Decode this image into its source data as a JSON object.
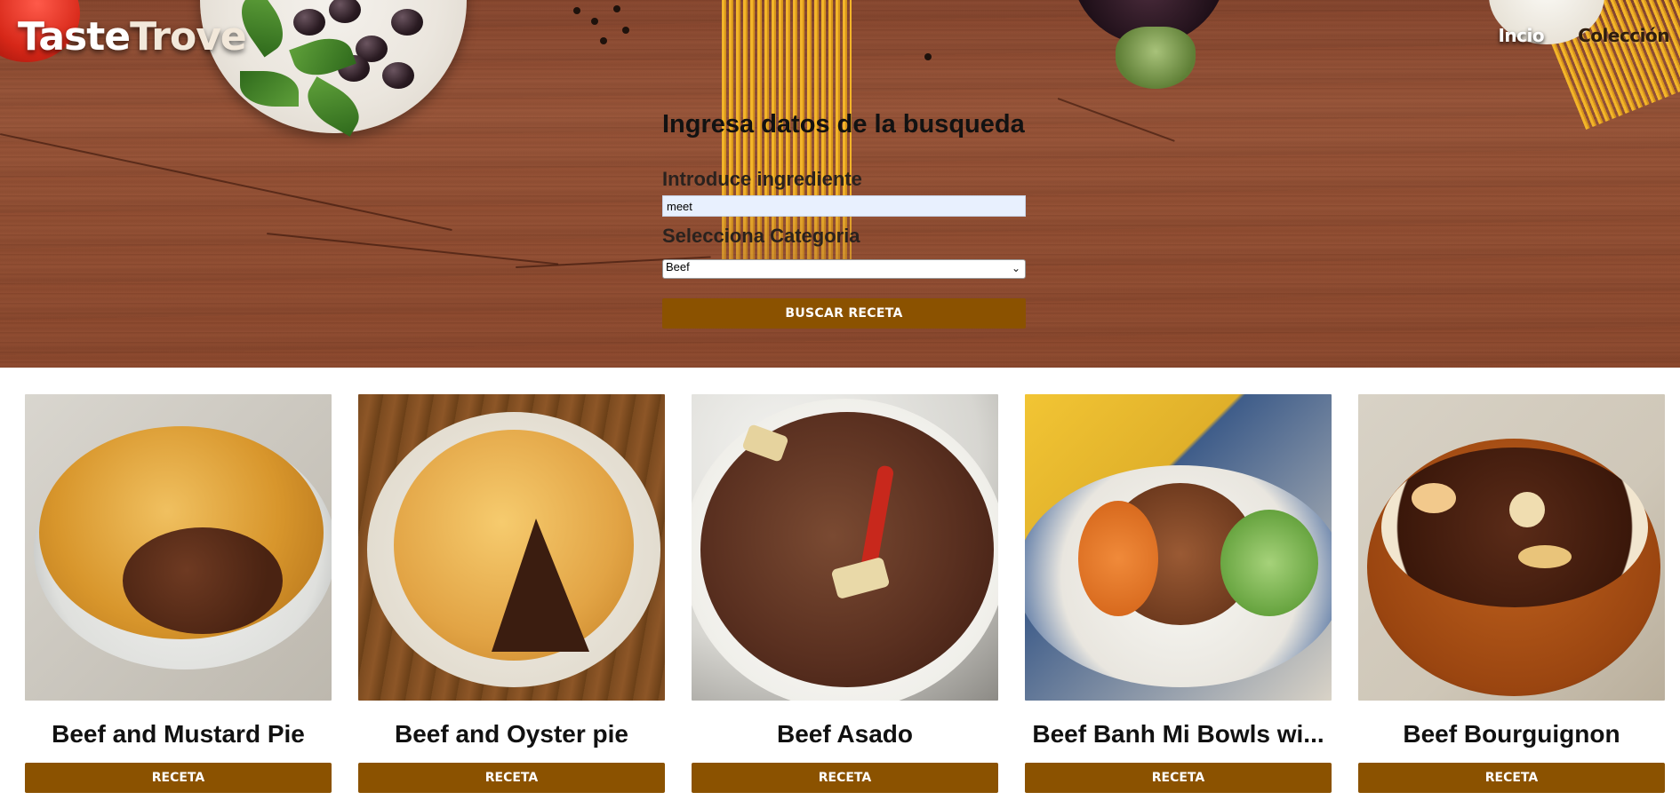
{
  "brand": {
    "part1": "Taste",
    "part2": "Trove"
  },
  "nav": {
    "items": [
      {
        "label": "Incio"
      },
      {
        "label": "Colección"
      }
    ]
  },
  "search": {
    "heading": "Ingresa datos de la busqueda",
    "ingredient_label": "Introduce ingrediente",
    "ingredient_value": "meet",
    "category_label": "Selecciona Categoria",
    "category_selected": "Beef",
    "button_label": "BUSCAR RECETA"
  },
  "recipes": [
    {
      "title": "Beef and Mustard Pie",
      "button_label": "RECETA"
    },
    {
      "title": "Beef and Oyster pie",
      "button_label": "RECETA"
    },
    {
      "title": "Beef Asado",
      "button_label": "RECETA"
    },
    {
      "title": "Beef Banh Mi Bowls wi...",
      "button_label": "RECETA"
    },
    {
      "title": "Beef Bourguignon",
      "button_label": "RECETA"
    }
  ],
  "colors": {
    "accent": "#8b5200",
    "hero_wood": "#955236",
    "nav_active": "#2e1d0e"
  }
}
